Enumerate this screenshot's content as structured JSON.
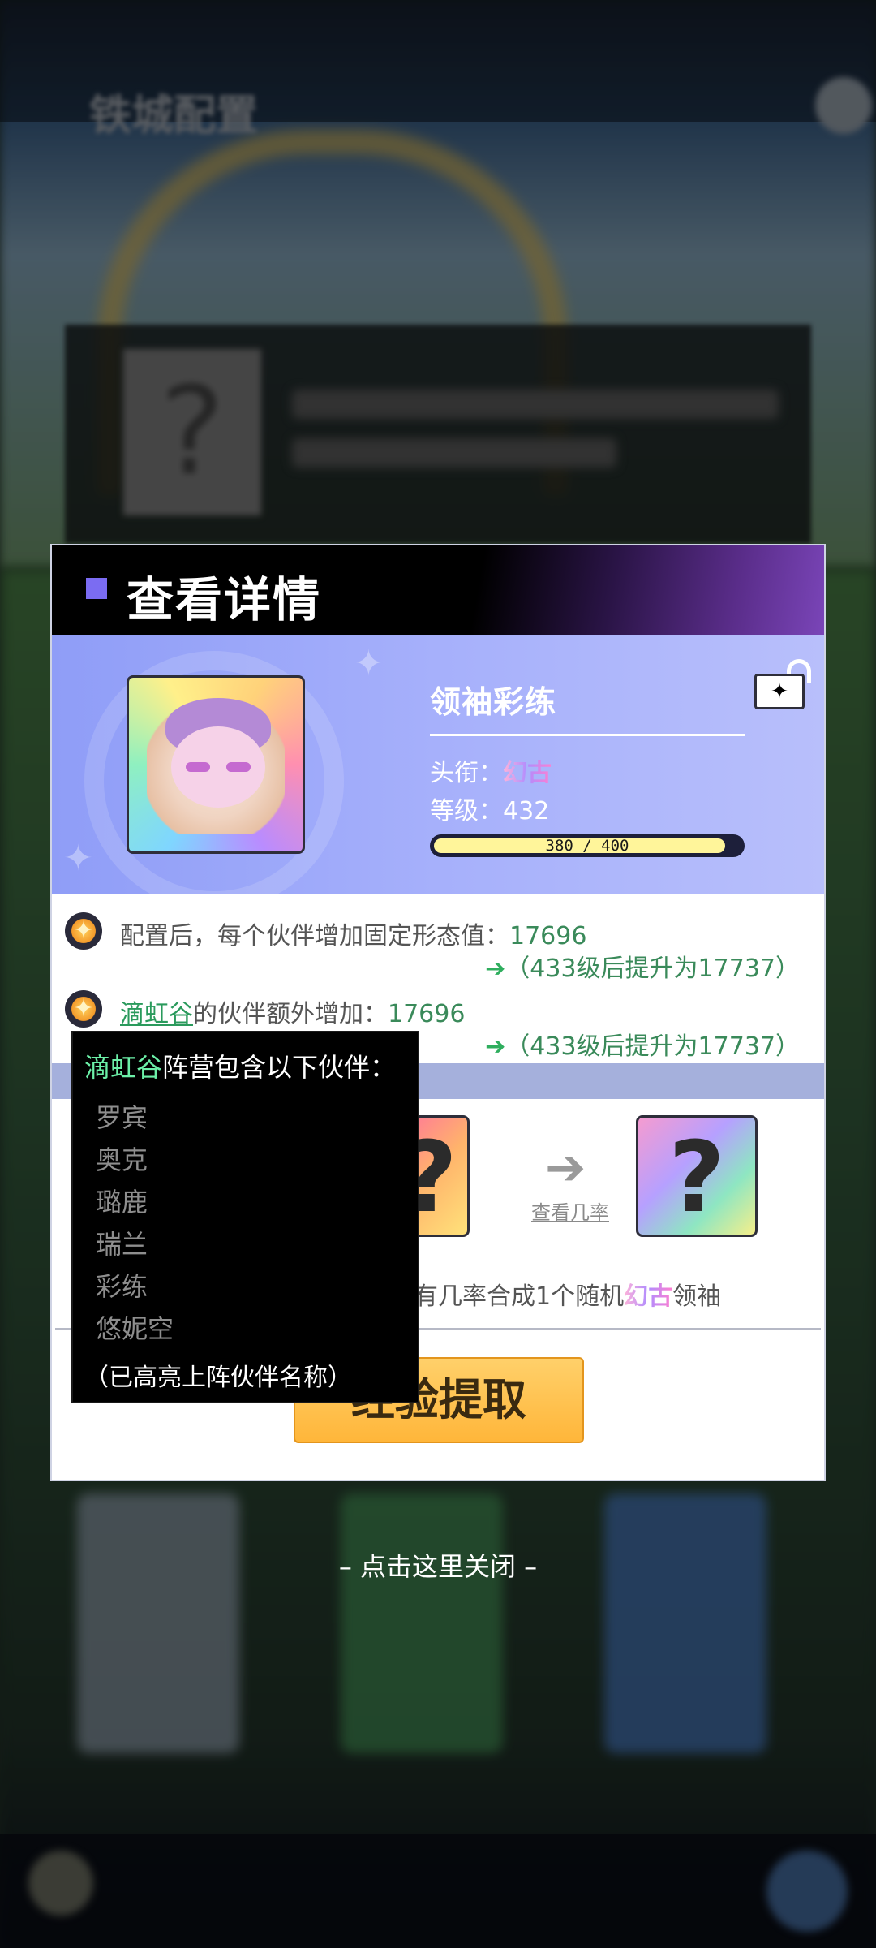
{
  "background": {
    "title": "铁城配置"
  },
  "dialog": {
    "title": "查看详情",
    "partner": {
      "name": "领袖彩练",
      "title_label": "头衔：",
      "title_value": "幻古",
      "level_label": "等级：",
      "level_value": "432",
      "xp_text": "380 / 400",
      "xp_current": 380,
      "xp_max": 400
    },
    "bonus1": {
      "text_prefix": "配置后，每个伙伴增加固定形态值：",
      "value": "17696",
      "upgrade_arrow": "➔",
      "upgrade_text": "（433级后提升为17737）"
    },
    "bonus2": {
      "faction": "滴虹谷",
      "text_middle": "的伙伴额外增加：",
      "value": "17696",
      "upgrade_arrow": "➔",
      "upgrade_text": "（433级后提升为17737）"
    },
    "synthesis": {
      "left_card": "?",
      "right_card": "?",
      "view_odds": "查看几率",
      "desc_prefix": "有几率合成1个随机",
      "desc_rank": "幻古",
      "desc_suffix": "领袖"
    },
    "extract_button": "经验提取"
  },
  "popup": {
    "faction": "滴虹谷",
    "head_suffix": "阵营包含以下伙伴：",
    "members": [
      "罗宾",
      "奥克",
      "璐鹿",
      "瑞兰",
      "彩练",
      "悠妮空"
    ],
    "note": "（已高亮上阵伙伴名称）"
  },
  "close_hint": "– 点击这里关闭 –"
}
